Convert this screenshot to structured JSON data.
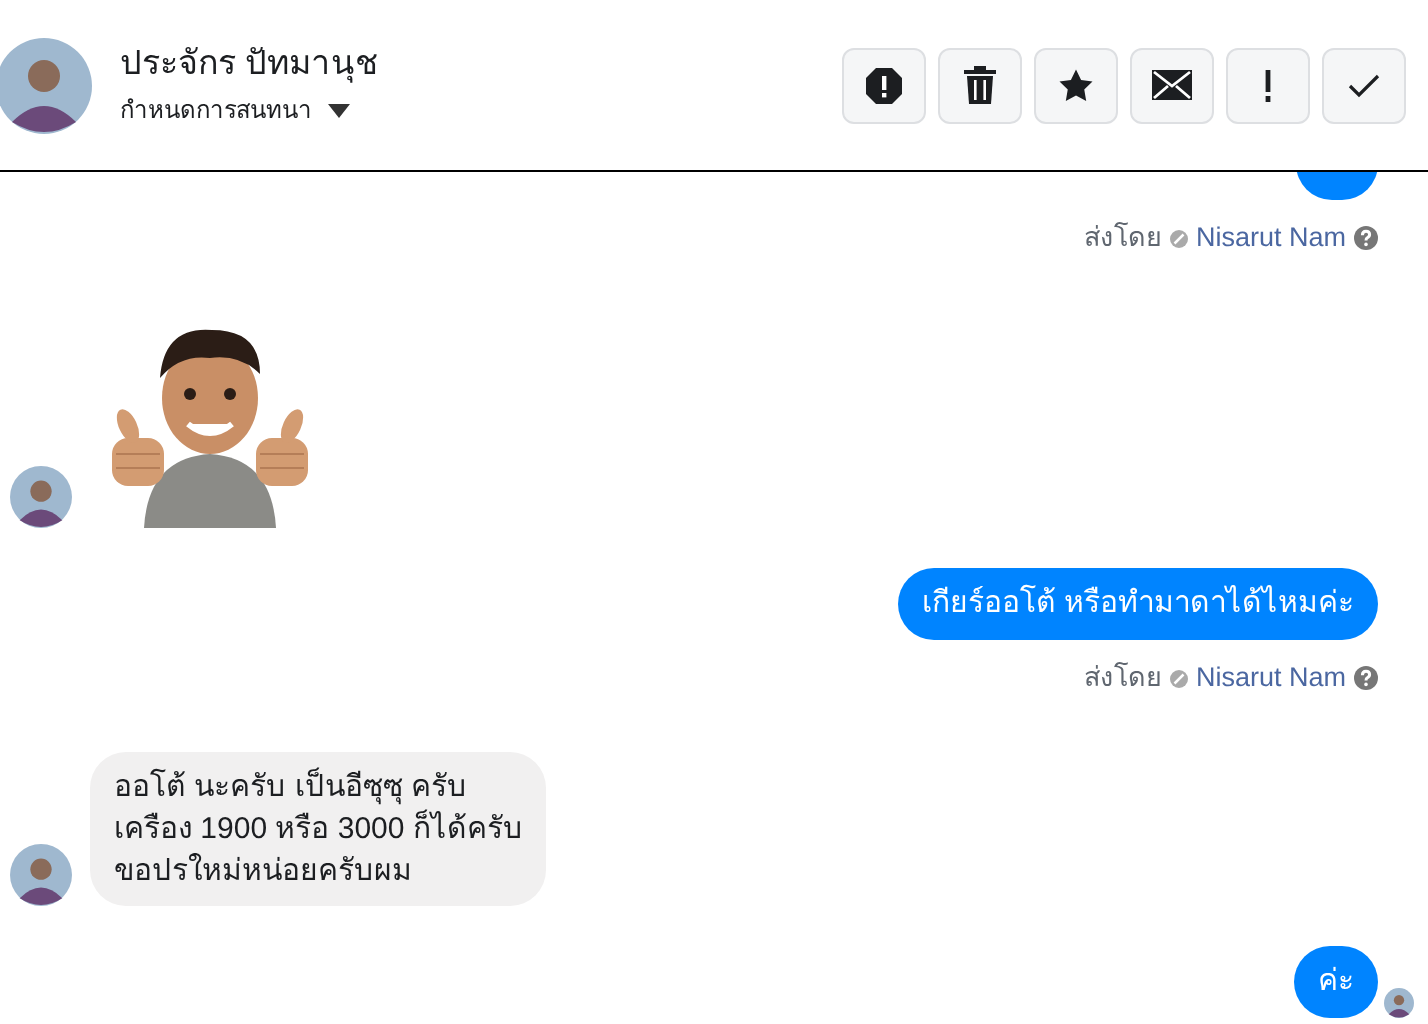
{
  "header": {
    "name": "ประจักร ปัทมานุช",
    "subtitle": "กำหนดการสนทนา"
  },
  "messages": [
    {
      "kind": "outgoing_cut"
    },
    {
      "kind": "sent_by",
      "label": "ส่งโดย",
      "sender": "Nisarut Nam"
    },
    {
      "kind": "sticker"
    },
    {
      "kind": "outgoing",
      "text": "เกียร์ออโต้ หรือทำมาดาได้ไหมค่ะ",
      "seen": false
    },
    {
      "kind": "sent_by",
      "label": "ส่งโดย",
      "sender": "Nisarut Nam"
    },
    {
      "kind": "incoming",
      "text": "ออโต้ นะครับ เป็นอีซุซุ ครับ\nเครือง 1900 หรือ 3000 ก็ได้ครับ\nขอปรใหม่หน่อยครับผม"
    },
    {
      "kind": "outgoing",
      "text": "ค่ะ",
      "seen": true
    }
  ]
}
